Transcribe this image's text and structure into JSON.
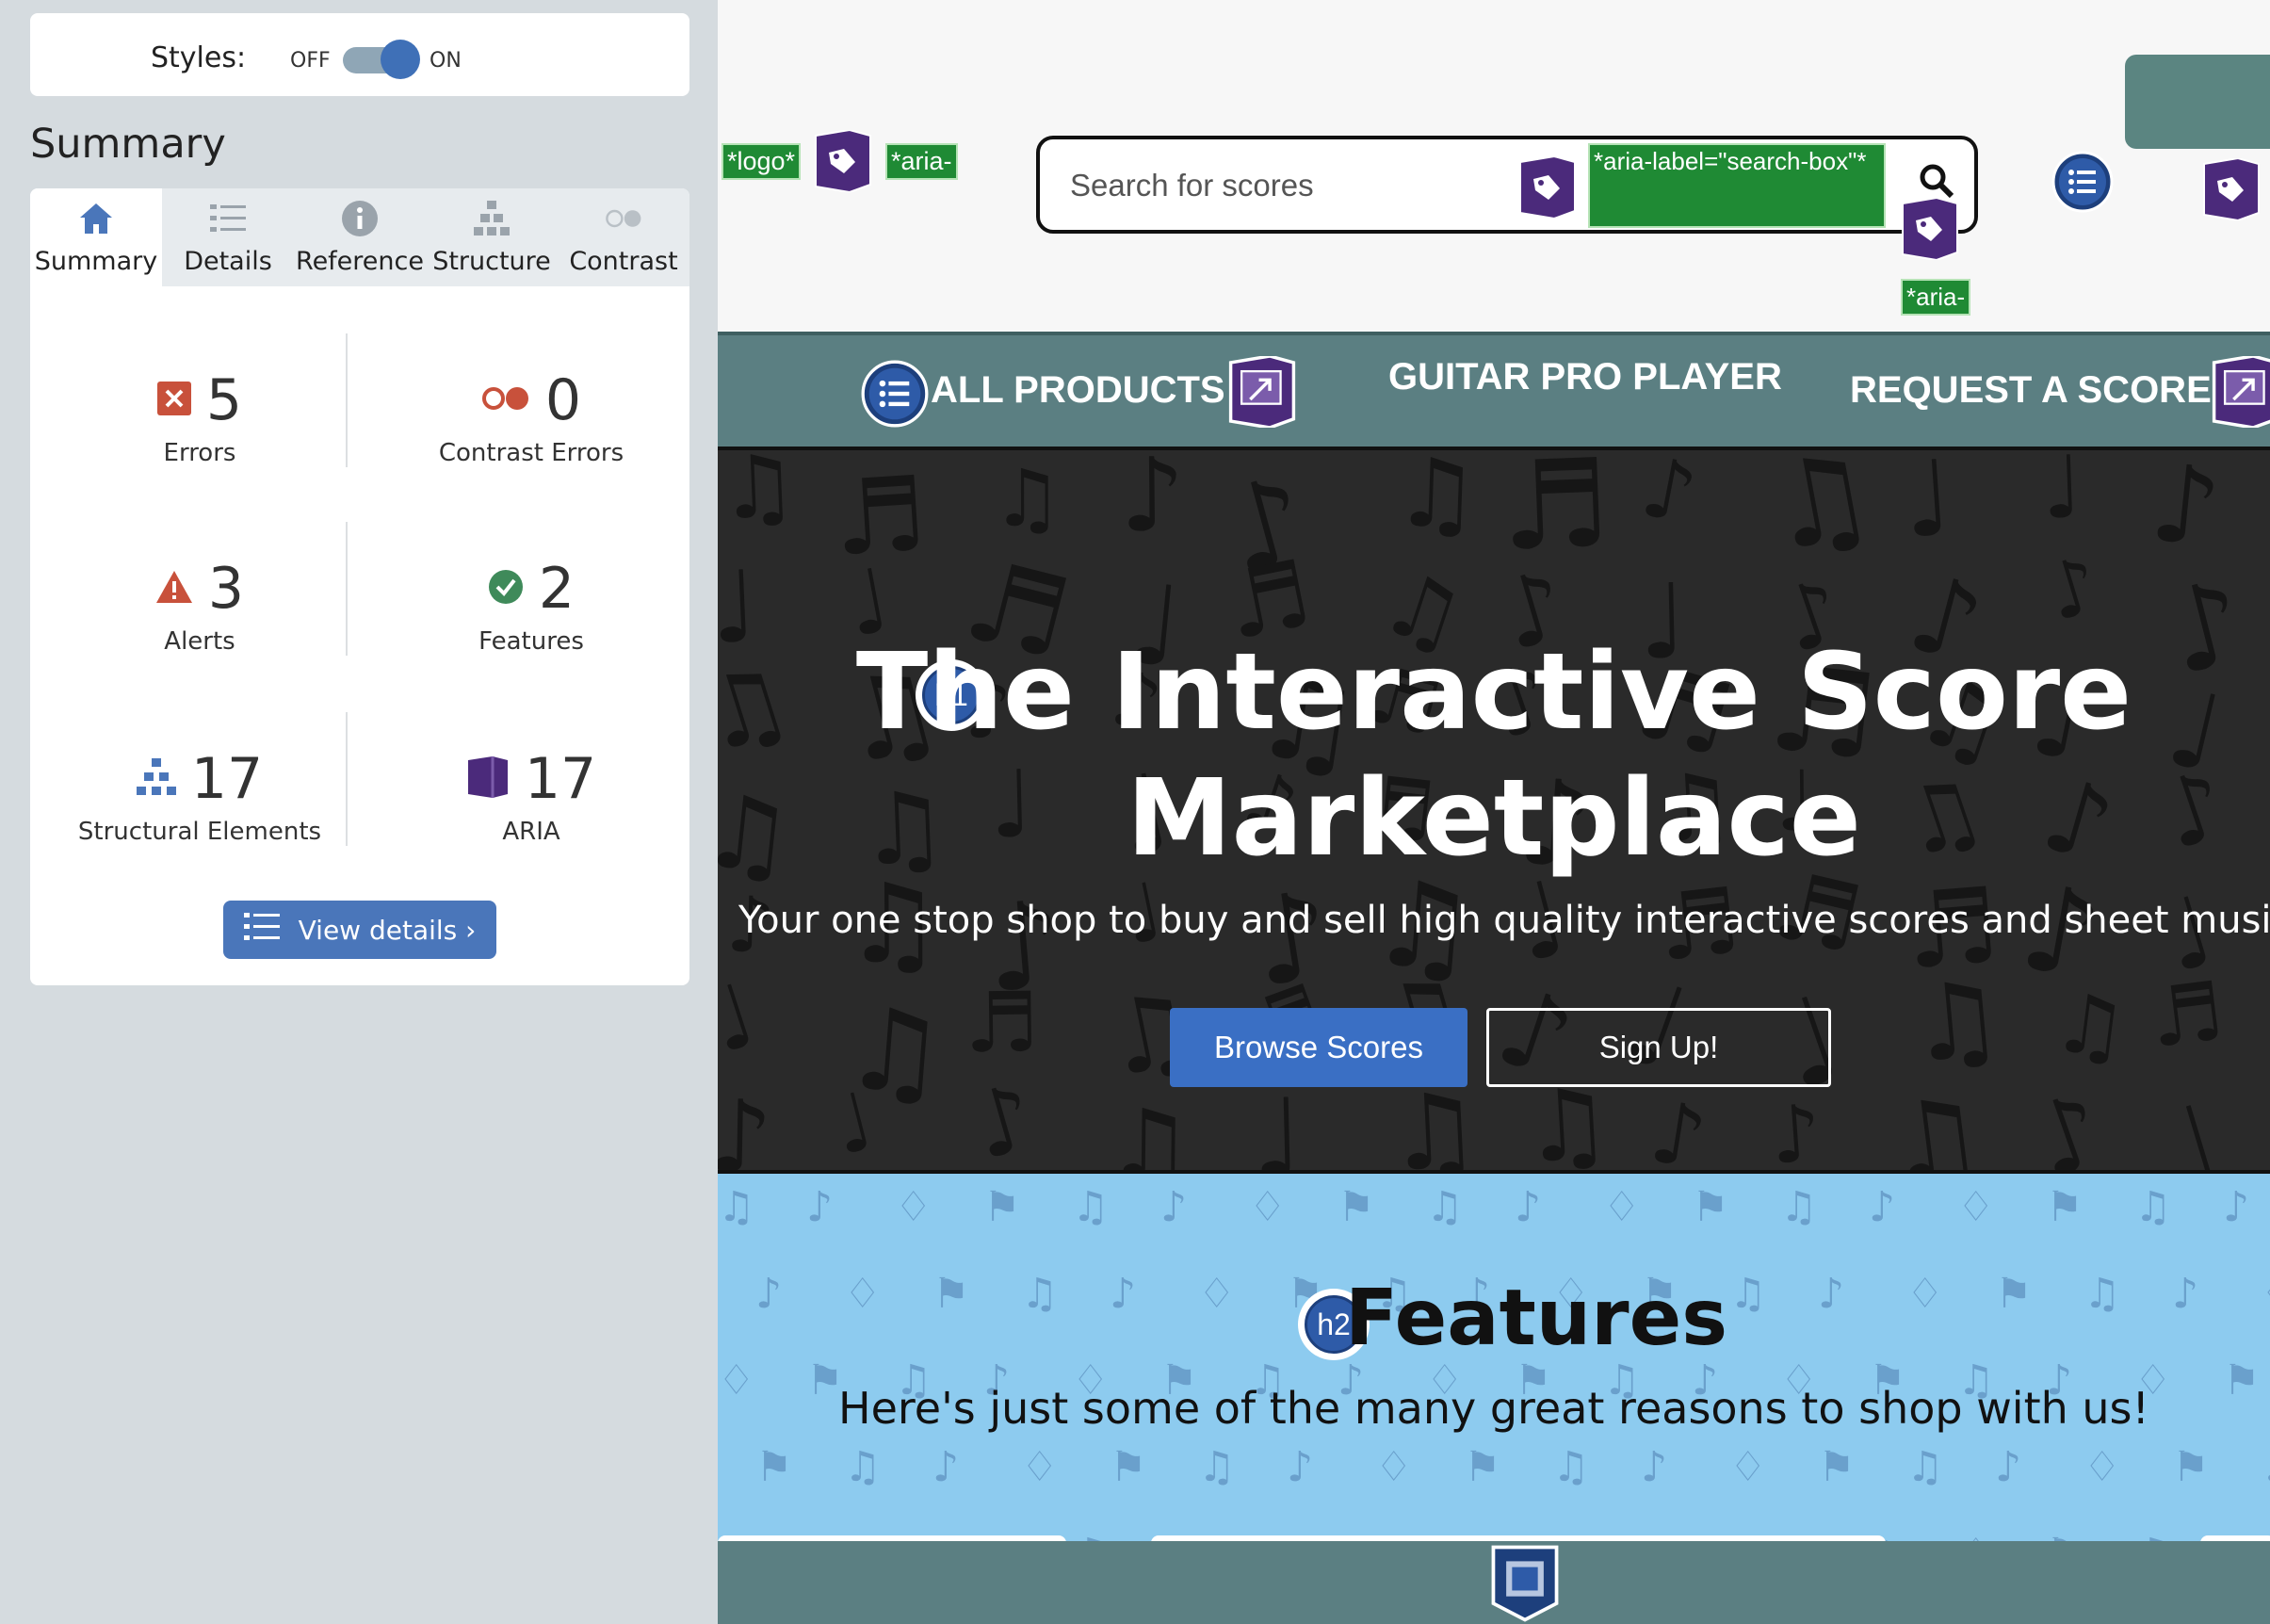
{
  "sidebar": {
    "styles": {
      "label": "Styles:",
      "off": "OFF",
      "on": "ON",
      "state": "on"
    },
    "heading": "Summary",
    "tabs": [
      {
        "label": "Summary",
        "icon": "home-icon",
        "active": true
      },
      {
        "label": "Details",
        "icon": "list-icon",
        "active": false
      },
      {
        "label": "Reference",
        "icon": "info-icon",
        "active": false
      },
      {
        "label": "Structure",
        "icon": "hierarchy-icon",
        "active": false
      },
      {
        "label": "Contrast",
        "icon": "contrast-icon",
        "active": false
      }
    ],
    "stats": {
      "errors": {
        "value": "5",
        "label": "Errors",
        "icon": "error-icon",
        "color": "#c8513b"
      },
      "contrast_errors": {
        "value": "0",
        "label": "Contrast Errors",
        "icon": "contrast-error-icon",
        "color": "#c8513b"
      },
      "alerts": {
        "value": "3",
        "label": "Alerts",
        "icon": "alert-icon",
        "color": "#c8513b"
      },
      "features": {
        "value": "2",
        "label": "Features",
        "icon": "feature-check-icon",
        "color": "#3f8a5a"
      },
      "structural": {
        "value": "17",
        "label": "Structural Elements",
        "icon": "structure-icon",
        "color": "#4a76ba"
      },
      "aria": {
        "value": "17",
        "label": "ARIA",
        "icon": "aria-icon",
        "color": "#4b2a7b"
      }
    },
    "view_details": "View details ›"
  },
  "page": {
    "wave_tags": {
      "logo": "*logo*",
      "aria_header": "*aria-",
      "search_aria": "*aria-label=\"search-box\"*",
      "aria_under_search": "*aria-"
    },
    "search": {
      "placeholder": "Search for scores"
    },
    "nav": {
      "all_products": "ALL PRODUCTS",
      "guitar_pro_player": "GUITAR PRO PLAYER",
      "request_a_score": "REQUEST A SCORE"
    },
    "hero": {
      "heading_level": "h1",
      "title": "The Interactive Score Marketplace",
      "subtitle": "Your one stop shop to buy and sell high quality interactive scores and sheet music",
      "browse_label": "Browse Scores",
      "signup_label": "Sign Up!"
    },
    "features": {
      "heading_level": "h2",
      "title": "Features",
      "subtitle": "Here's just some of the many great reasons to shop with us!"
    }
  },
  "colors": {
    "accent": "#4a76ba",
    "aria_purple": "#4b2a7b",
    "wave_green": "#1f8a34",
    "nav_teal": "#5b7f82",
    "features_blue": "#8dcbef"
  }
}
